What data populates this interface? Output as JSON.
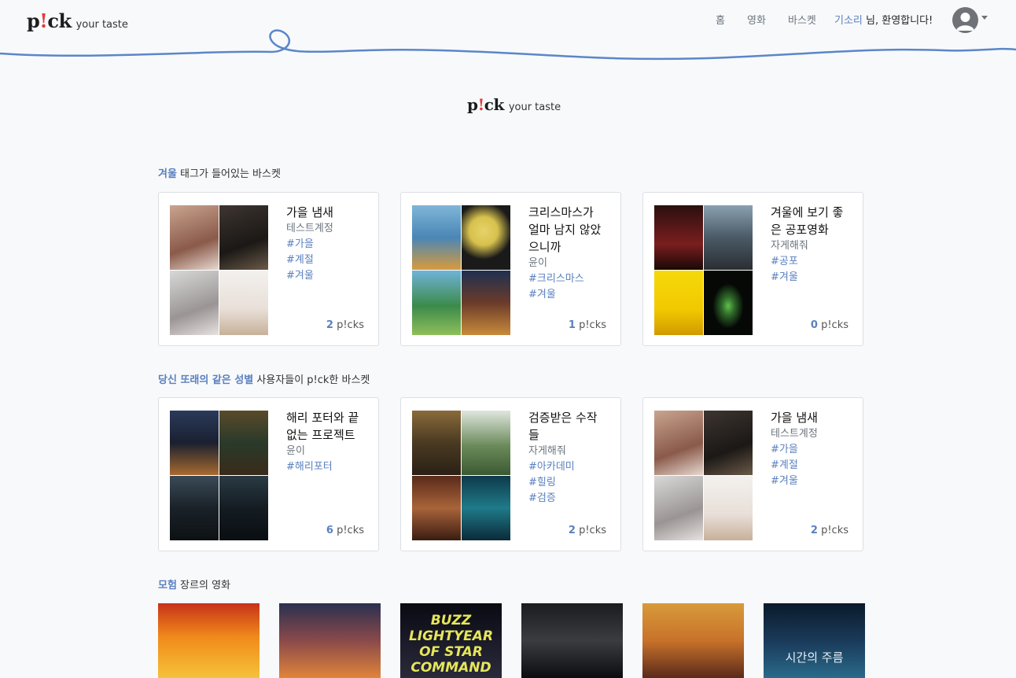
{
  "nav": {
    "logo_mark_left": "p",
    "logo_mark_bang": "!",
    "logo_mark_right": "ck",
    "logo_sub": "your taste",
    "links": [
      "홈",
      "영화",
      "바스켓"
    ],
    "user_name": "기소리",
    "greeting_suffix": " 님, 환영합니다!"
  },
  "hero": {
    "logo_mark_left": "p",
    "logo_mark_bang": "!",
    "logo_mark_right": "ck",
    "logo_sub": "your taste"
  },
  "sections": [
    {
      "highlight": "겨울",
      "rest": " 태그가 들어있는 바스켓"
    },
    {
      "highlight": "당신 또래의 같은 성별",
      "rest": " 사용자들이 p!ck한 바스켓"
    },
    {
      "highlight": "모험",
      "rest": " 장르의 영화"
    }
  ],
  "baskets_winter": [
    {
      "title": "가을 냄새",
      "author": "테스트계정",
      "tags": [
        "#가을",
        "#계절",
        "#겨울"
      ],
      "picks": "2",
      "picks_label": " p!cks"
    },
    {
      "title": "크리스마스가 얼마 남지 않았으니까",
      "author": "윤이",
      "tags": [
        "#크리스마스",
        "#겨울"
      ],
      "picks": "1",
      "picks_label": " p!cks"
    },
    {
      "title": "겨울에 보기 좋은 공포영화",
      "author": "자게해줘",
      "tags": [
        "#공포",
        "#겨울"
      ],
      "picks": "0",
      "picks_label": " p!cks"
    }
  ],
  "baskets_peers": [
    {
      "title": "해리 포터와 끝없는 프로젝트",
      "author": "윤이",
      "tags": [
        "#해리포터"
      ],
      "picks": "6",
      "picks_label": " p!cks"
    },
    {
      "title": "검증받은 수작들",
      "author": "자게해줘",
      "tags": [
        "#아카데미",
        "#힐링",
        "#검증"
      ],
      "picks": "2",
      "picks_label": " p!cks"
    },
    {
      "title": "가을 냄새",
      "author": "테스트계정",
      "tags": [
        "#가을",
        "#계절",
        "#겨울"
      ],
      "picks": "2",
      "picks_label": " p!cks"
    }
  ],
  "adventure_posters": [
    {
      "text": ""
    },
    {
      "text": ""
    },
    {
      "text": "BUZZ LIGHTYEAR OF STAR COMMAND"
    },
    {
      "text": ""
    },
    {
      "text": ""
    },
    {
      "text": "시간의 주름"
    }
  ],
  "colors": {
    "accent": "#5a80bf",
    "wave": "#5b86c9",
    "bang": "#e23b3b"
  }
}
